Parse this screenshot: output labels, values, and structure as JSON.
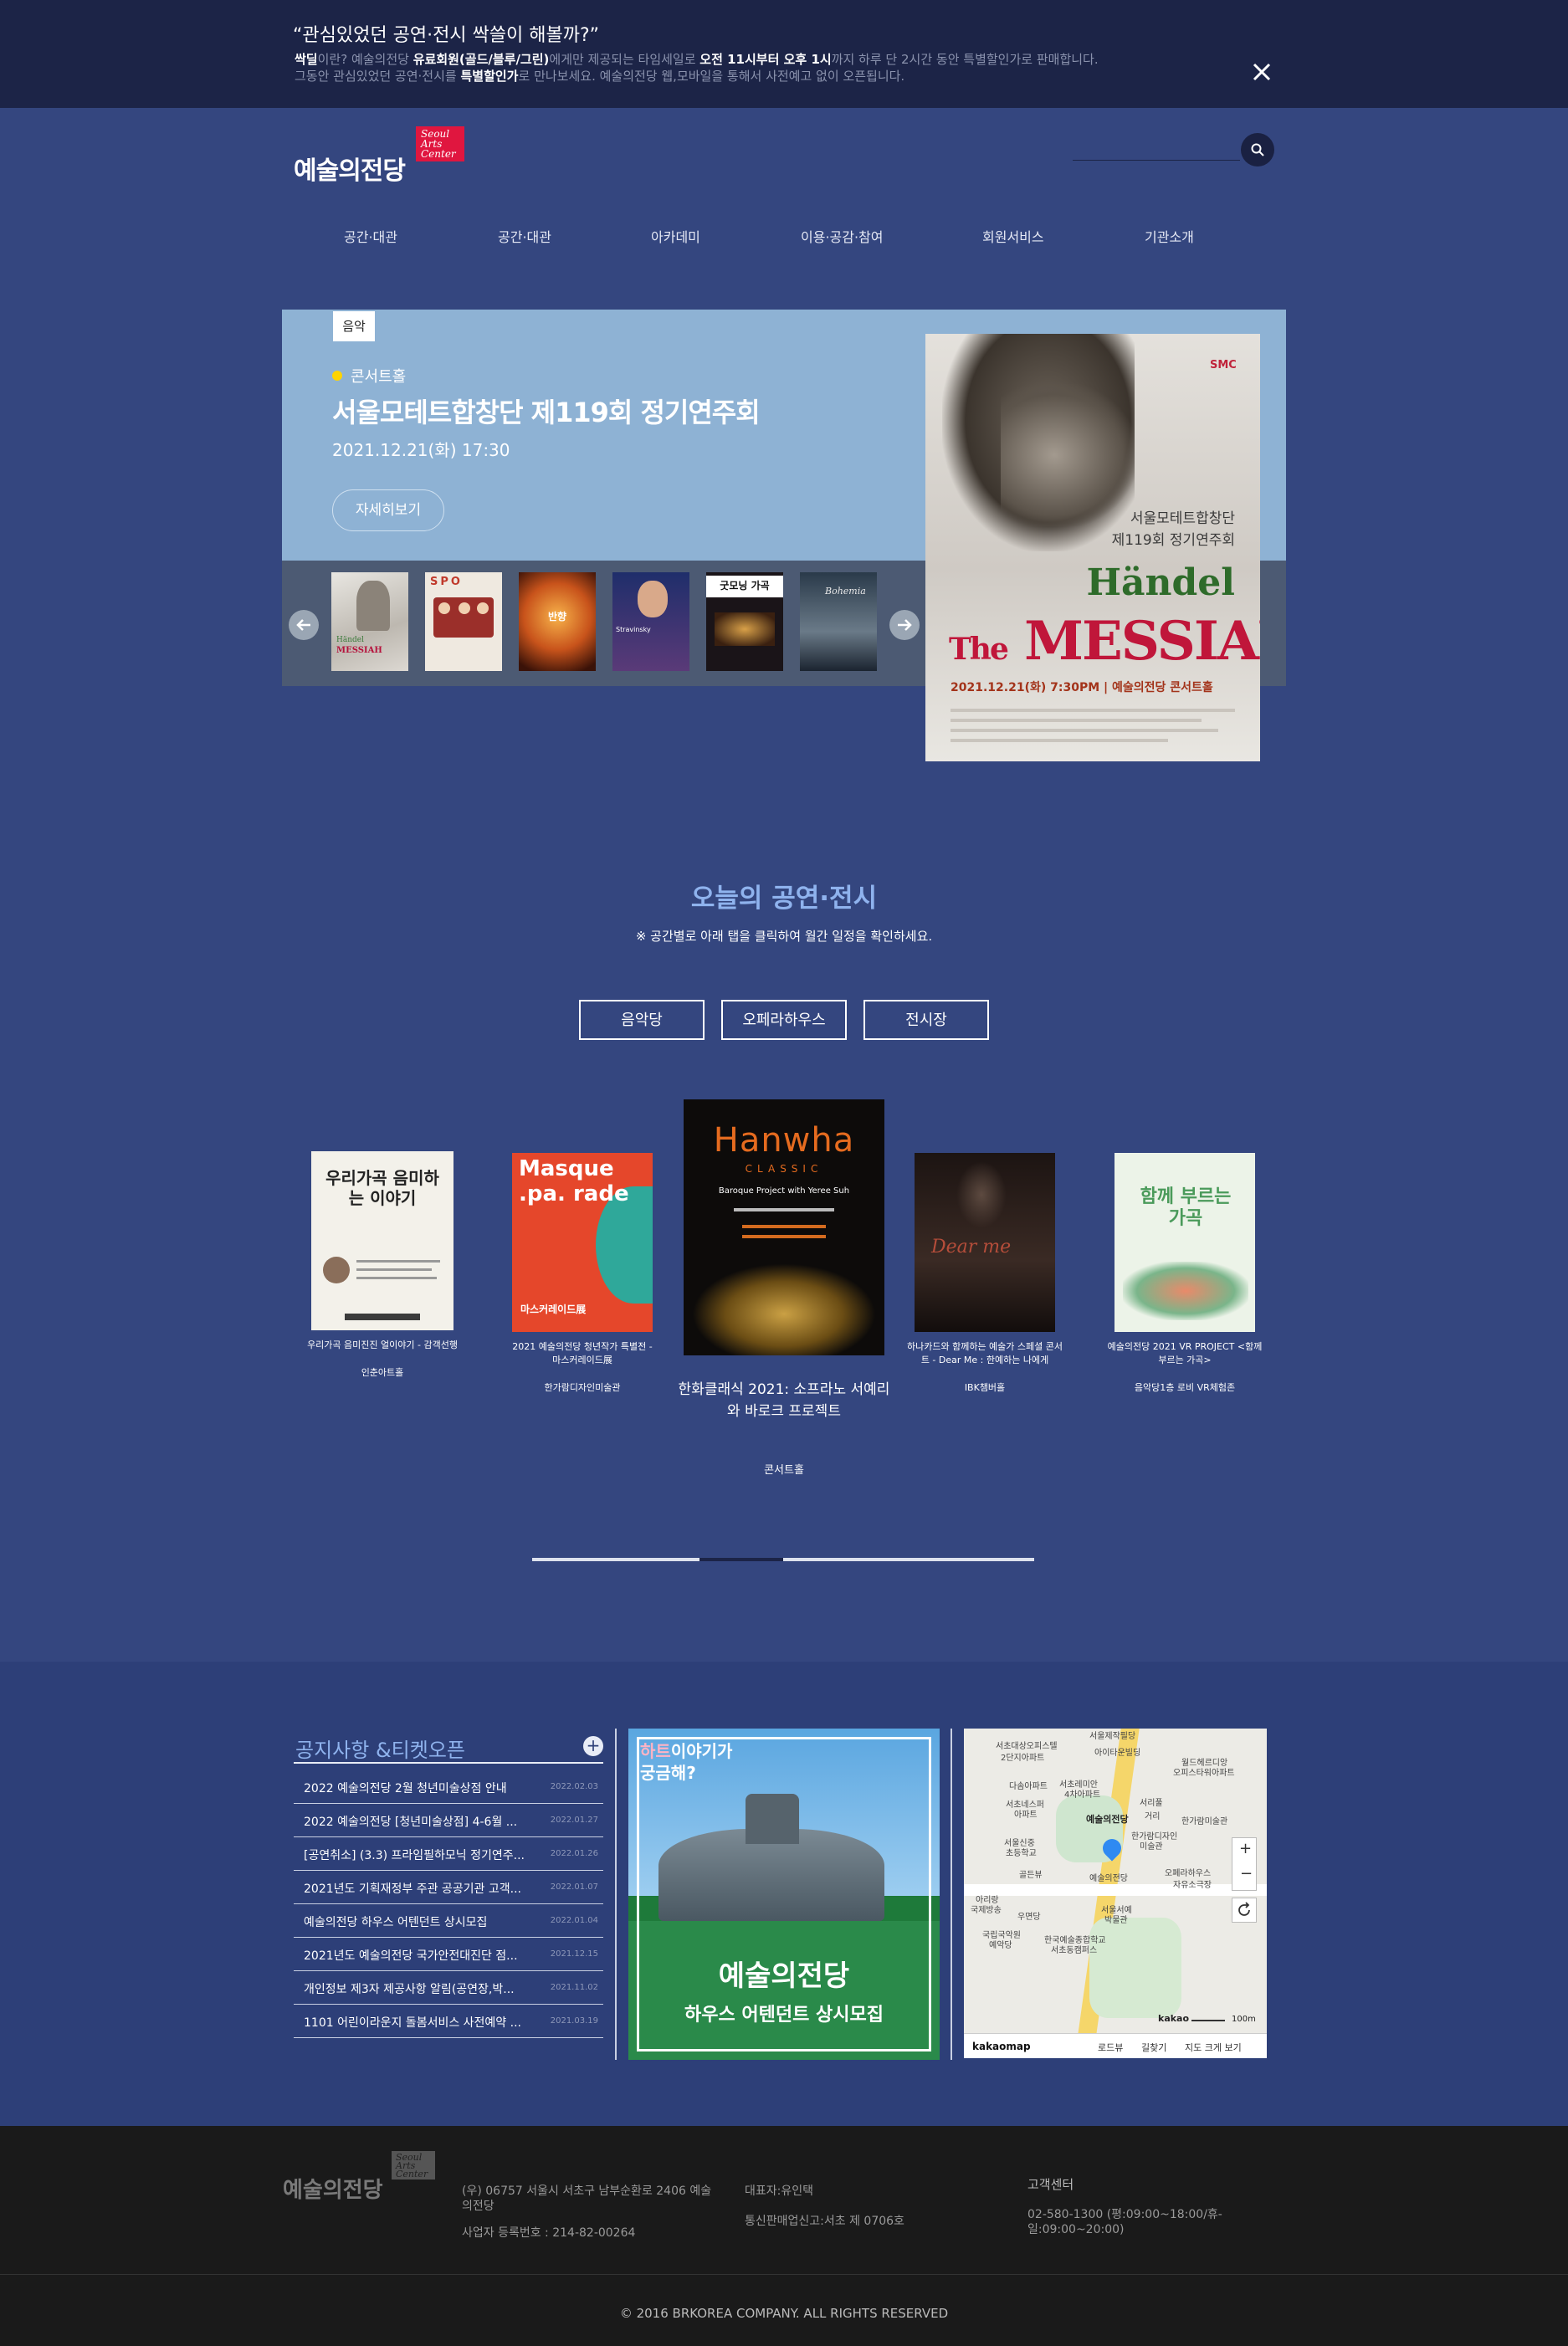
{
  "notice": {
    "quote": "“관심있었던 공연·전시 싹쓸이 해볼까?”",
    "line1_a": "싹딜",
    "line1_b": "이란? 예술의전당 ",
    "line1_c": "유료회원(골드/블루/그린)",
    "line1_d": "에게만 제공되는 타임세일로 ",
    "line1_e": "오전 11시부터 오후 1시",
    "line1_f": "까지 하루 단 2시간 동안 특별할인가로 판매합니다.",
    "line2_a": "그동안 관심있었던 공연·전시를 ",
    "line2_b": "특별할인가",
    "line2_c": "로 만나보세요. 예술의전당 웹,모바일을 통해서 사전예고 없이 오픈됩니다.",
    "close_icon": "close-icon"
  },
  "header": {
    "logo_ko": "예술의전당",
    "logo_badge": [
      "Seoul",
      "Arts",
      "Center"
    ],
    "search_placeholder": ""
  },
  "nav": [
    "공간·대관",
    "공간·대관",
    "아카데미",
    "이용·공감·참여",
    "회원서비스",
    "기관소개"
  ],
  "hero": {
    "tag": "음악",
    "venue": "콘서트홀",
    "title": "서울모테트합창단 제119회 정기연주회",
    "date": "2021.12.21(화) 17:30",
    "detail_button": "자세히보기",
    "poster": {
      "corner": "SMC",
      "sub1": "서울모테트합창단",
      "sub2": "제119회 정기연주회",
      "composer": "Händel",
      "work_a": "The",
      "work_b": "MESSIAH",
      "when": "2021.12.21(화) 7:30PM | 예술의전당 콘서트홀"
    },
    "thumbnails": [
      "Händel The Messiah",
      "SPO",
      "반향",
      "Stravinsky",
      "굿모닝 가곡",
      "Bohemia"
    ]
  },
  "today": {
    "title": "오늘의 공연·전시",
    "subtitle": "※ 공간별로 아래 탭을 클릭하여 월간 일정을 확인하세요.",
    "tabs": [
      "음악당",
      "오페라하우스",
      "전시장"
    ],
    "cards": [
      {
        "poster_text": "우리가곡 음미하는 이야기",
        "title": "우리가곡 음미진진 얼이야기 - 감객선행",
        "venue": "인춘아트홀"
      },
      {
        "poster_text": "Masque .pa. rade",
        "poster_sub": "마스커레이드展",
        "title": "2021 예술의전당 청년작가 특별전 - 마스커레이드展",
        "venue": "한가람디자인미술관"
      },
      {
        "poster_text": "Hanwha",
        "poster_sub": "CLASSIC",
        "poster_caption": "Baroque Project with Yeree Suh",
        "title": "한화클래식 2021: 소프라노 서예리와 바로크 프로젝트",
        "venue": "콘서트홀"
      },
      {
        "poster_text": "Dear me",
        "title": "하나카드와 함께하는 예술가 스페셜 콘서트 - Dear Me : 한예하는 나에게",
        "venue": "IBK챔버홀"
      },
      {
        "poster_text": "함께 부르는 가곡",
        "title": "예술의전당 2021 VR PROJECT <함께부르는 가곡>",
        "venue": "음악당1층 로비 VR체험존"
      }
    ],
    "progress": 0.4
  },
  "notices": {
    "title": "공지사항 &티켓오픈",
    "more_label": "+",
    "items": [
      {
        "title": "2022 예술의전당 2월 청년미술상점 안내",
        "date": "2022.02.03"
      },
      {
        "title": "2022 예술의전당 [청년미술상점] 4-6월 ...",
        "date": "2022.01.27"
      },
      {
        "title": "[공연취소] (3.3) 프라임필하모닉 정기연주...",
        "date": "2022.01.26"
      },
      {
        "title": "2021년도 기획재정부 주관 공공기관 고객...",
        "date": "2022.01.07"
      },
      {
        "title": "예술의전당 하우스 어텐던트 상시모집",
        "date": "2022.01.04"
      },
      {
        "title": "2021년도 예술의전당 국가안전대진단 점...",
        "date": "2021.12.15"
      },
      {
        "title": "개인정보 제3자 제공사항 알림(공연장,박...",
        "date": "2021.11.02"
      },
      {
        "title": "1101 어린이라운지 돌봄서비스 사전예약 ...",
        "date": "2021.03.19"
      }
    ]
  },
  "promo": {
    "bubble1": "하트",
    "bubble2": "이야기가",
    "bubble3": "궁금해?",
    "line1": "예술의전당",
    "line2": "하우스 어텐던트 상시모집"
  },
  "map": {
    "labels": [
      "서울제작필당",
      "서초대상오피스텔",
      "아이타운빌딩",
      "2단지아파트",
      "월드헤르디앙",
      "오피스타워아파트",
      "다솜아파트",
      "서초레미안",
      "4차아파트",
      "서리풀",
      "서초네스퍼",
      "아파트",
      "예술의전당",
      "한가람미술관",
      "거리",
      "한가람디자인",
      "미술관",
      "서울신중",
      "초등학교",
      "예술의전당",
      "골든뷰",
      "오페라하우스",
      "자유소극장",
      "아리랑",
      "국제방송",
      "우면당",
      "서울서예",
      "박물관",
      "국립국악원",
      "예악당",
      "한국예술종합학교",
      "서초동캠퍼스"
    ],
    "logo": "kakaomap",
    "scale_brand": "kakao",
    "scale": "100m",
    "links": [
      "로드뷰",
      "길찾기",
      "지도 크게 보기"
    ]
  },
  "footer": {
    "logo_ko": "예술의전당",
    "logo_badge": [
      "Seoul",
      "Arts",
      "Center"
    ],
    "address": "(우) 06757 서울시 서초구 남부순환로 2406 예술의전당",
    "biz_no": "사업자 등록번호 : 214-82-00264",
    "ceo": "대표자:유인택",
    "sale_reg": "통신판매업신고:서초 제 0706호",
    "cs_title": "고객센터",
    "cs_hours": "02-580-1300 (평:09:00~18:00/휴-일:09:00~20:00)",
    "copyright": "© 2016 BRKOREA COMPANY. ALL RIGHTS RESERVED"
  }
}
